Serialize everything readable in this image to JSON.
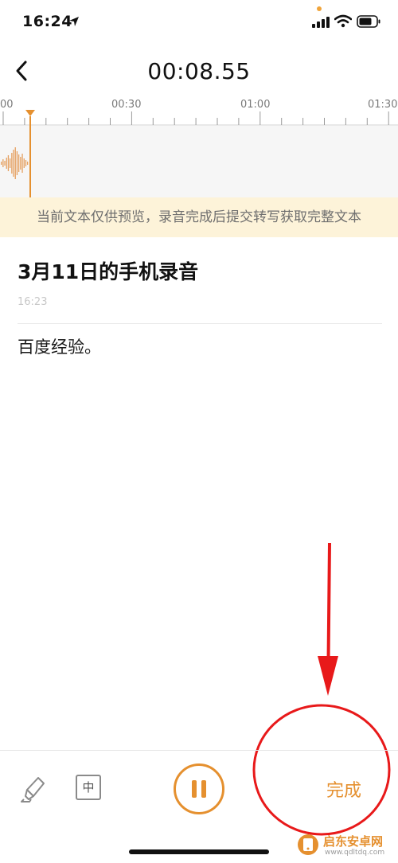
{
  "status_bar": {
    "time": "16:24"
  },
  "header": {
    "timer": "00:08.55"
  },
  "timeline": {
    "labels": [
      "00",
      "00:30",
      "01:00",
      "01:30"
    ]
  },
  "notice": {
    "text": "当前文本仅供预览，录音完成后提交转写获取完整文本"
  },
  "recording": {
    "title": "3月11日的手机录音",
    "time": "16:23",
    "transcript": "百度经验。"
  },
  "toolbar": {
    "input_mode": "中",
    "done_label": "完成"
  },
  "watermark": {
    "title": "启东安卓网",
    "url": "www.qdltdq.com"
  },
  "colors": {
    "accent": "#e5902f",
    "notice_bg": "#fdf3d9",
    "annotation": "#e8191a"
  }
}
